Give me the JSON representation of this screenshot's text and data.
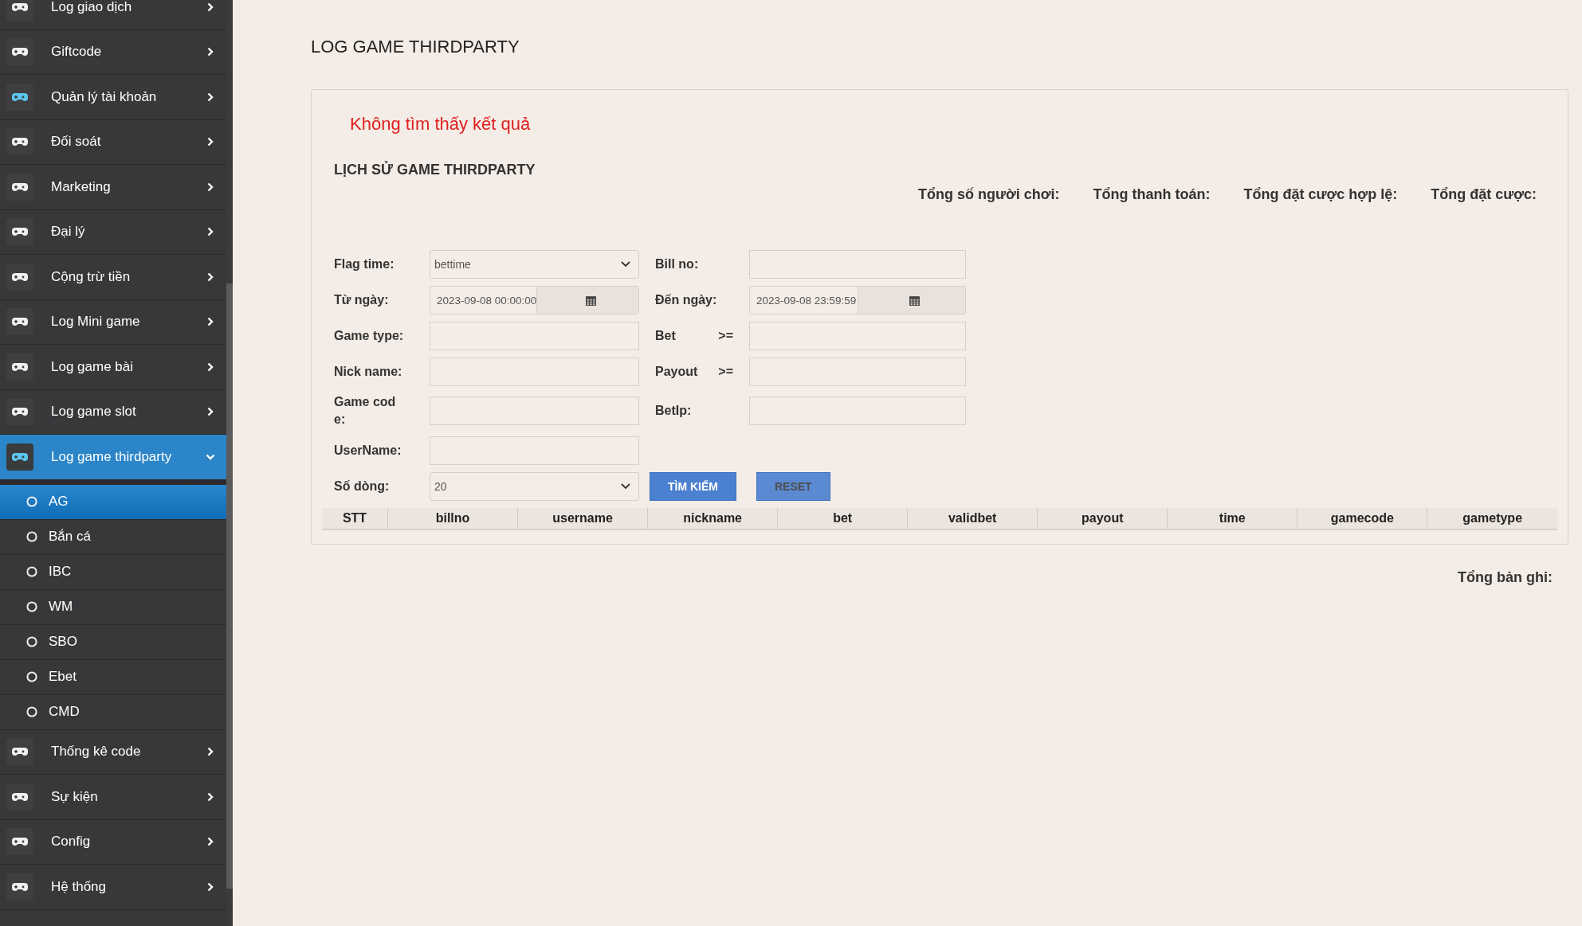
{
  "sidebar": {
    "items": [
      {
        "label": "Log giao dịch",
        "icon_active": false,
        "expanded": false,
        "selected": false
      },
      {
        "label": "Giftcode",
        "icon_active": false,
        "expanded": false,
        "selected": false
      },
      {
        "label": "Quản lý tài khoản",
        "icon_active": true,
        "expanded": false,
        "selected": false
      },
      {
        "label": "Đối soát",
        "icon_active": false,
        "expanded": false,
        "selected": false
      },
      {
        "label": "Marketing",
        "icon_active": false,
        "expanded": false,
        "selected": false
      },
      {
        "label": "Đại lý",
        "icon_active": false,
        "expanded": false,
        "selected": false
      },
      {
        "label": "Cộng trừ tiền",
        "icon_active": false,
        "expanded": false,
        "selected": false
      },
      {
        "label": "Log Mini game",
        "icon_active": false,
        "expanded": false,
        "selected": false
      },
      {
        "label": "Log game bài",
        "icon_active": false,
        "expanded": false,
        "selected": false
      },
      {
        "label": "Log game slot",
        "icon_active": false,
        "expanded": false,
        "selected": false
      },
      {
        "label": "Log game thirdparty",
        "icon_active": true,
        "expanded": true,
        "selected": true,
        "children": [
          {
            "label": "AG",
            "selected": true
          },
          {
            "label": "Bắn cá",
            "selected": false
          },
          {
            "label": "IBC",
            "selected": false
          },
          {
            "label": "WM",
            "selected": false
          },
          {
            "label": "SBO",
            "selected": false
          },
          {
            "label": "Ebet",
            "selected": false
          },
          {
            "label": "CMD",
            "selected": false
          }
        ]
      },
      {
        "label": "Thống kê code",
        "icon_active": false,
        "expanded": false,
        "selected": false
      },
      {
        "label": "Sự kiện",
        "icon_active": false,
        "expanded": false,
        "selected": false
      },
      {
        "label": "Config",
        "icon_active": false,
        "expanded": false,
        "selected": false
      },
      {
        "label": "Hệ thống",
        "icon_active": false,
        "expanded": false,
        "selected": false
      }
    ]
  },
  "page_title": "LOG GAME THIRDPARTY",
  "panel": {
    "error_message": "Không tìm thấy kết quả",
    "heading": "LỊCH SỬ GAME THIRDPARTY",
    "totals": [
      "Tổng số người chơi:",
      "Tổng thanh toán:",
      "Tổng đặt cược hợp lệ:",
      "Tổng đặt cược:"
    ],
    "form": {
      "rows": [
        {
          "fields": [
            {
              "label": "Flag time:",
              "kind": "select",
              "value": "bettime"
            },
            {
              "label": "Bill no:",
              "kind": "text"
            }
          ]
        },
        {
          "fields": [
            {
              "label": "Từ ngày:",
              "kind": "date",
              "value": "2023-09-08 00:00:00"
            },
            {
              "label": "Đến ngày:",
              "kind": "date",
              "value": "2023-09-08 23:59:59"
            }
          ]
        },
        {
          "fields": [
            {
              "label": "Game type:",
              "kind": "text"
            },
            {
              "label": "Bet",
              "operator": ">=",
              "kind": "text"
            }
          ]
        },
        {
          "fields": [
            {
              "label": "Nick name:",
              "kind": "text"
            },
            {
              "label": "Payout",
              "operator": ">=",
              "kind": "text"
            }
          ]
        },
        {
          "fields": [
            {
              "label": "Game cod e:",
              "kind": "text"
            },
            {
              "label": "BetIp:",
              "kind": "text"
            }
          ]
        },
        {
          "fields": [
            {
              "label": "UserName:",
              "kind": "text"
            }
          ]
        },
        {
          "fields": [
            {
              "label": "Số dòng:",
              "kind": "select",
              "value": "20"
            }
          ]
        }
      ],
      "buttons": [
        {
          "label": "TÌM KIẾM",
          "kind": "primary"
        },
        {
          "label": "RESET",
          "kind": "reset"
        }
      ]
    },
    "table": {
      "columns": [
        "STT",
        "billno",
        "username",
        "nickname",
        "bet",
        "validbet",
        "payout",
        "time",
        "gamecode",
        "gametype"
      ]
    }
  },
  "record_total": "Tổng bản ghi:"
}
